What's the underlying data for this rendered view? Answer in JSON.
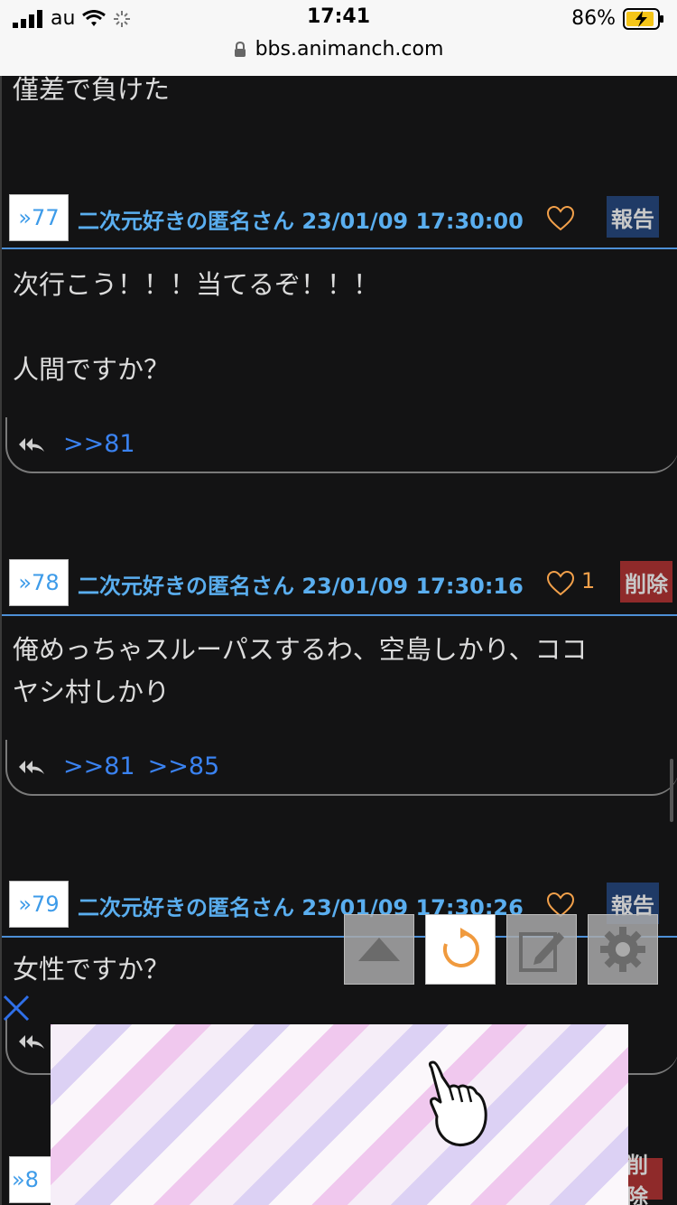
{
  "status_bar": {
    "carrier": "au",
    "time": "17:41",
    "battery": "86%",
    "url": "bbs.animanch.com"
  },
  "prev_post": {
    "body_line": "僅差で負けた"
  },
  "posts": [
    {
      "number": "»77",
      "author": "二次元好きの匿名さん",
      "datetime": "23/01/09 17:30:00",
      "likes": "",
      "tag": "報告",
      "body": [
        "次行こう！！！当てるぞ！！！",
        "",
        "人間ですか？"
      ],
      "replies": [
        ">>81"
      ]
    },
    {
      "number": "»78",
      "author": "二次元好きの匿名さん",
      "datetime": "23/01/09 17:30:16",
      "likes": "1",
      "tag": "削除",
      "body": [
        "俺めっちゃスルーパスするわ、空島しかり、ココ",
        "ヤシ村しかり"
      ],
      "replies": [
        ">>81",
        ">>85"
      ]
    },
    {
      "number": "»79",
      "author": "二次元好きの匿名さん",
      "datetime": "23/01/09 17:30:26",
      "likes": "",
      "tag": "報告",
      "body": [
        "女性ですか？"
      ],
      "replies": []
    }
  ],
  "next_post": {
    "number_partial": "»8",
    "tag_partial": "削除"
  },
  "icons": {
    "scroll_up": "triangle-up-icon",
    "reload": "reload-icon",
    "compose": "pencil-icon",
    "settings": "gear-icon",
    "reply": "reply-all-icon",
    "heart": "heart-icon",
    "ad_close": "close-icon",
    "ad_pointer": "pointing-hand-icon"
  },
  "colors": {
    "background": "#131314",
    "link_blue": "#3a82f0",
    "meta_blue": "#5aaeef",
    "heart_orange": "#f2a04a",
    "report_bg": "#1f3a66",
    "delete_bg": "#8f2a2a"
  }
}
